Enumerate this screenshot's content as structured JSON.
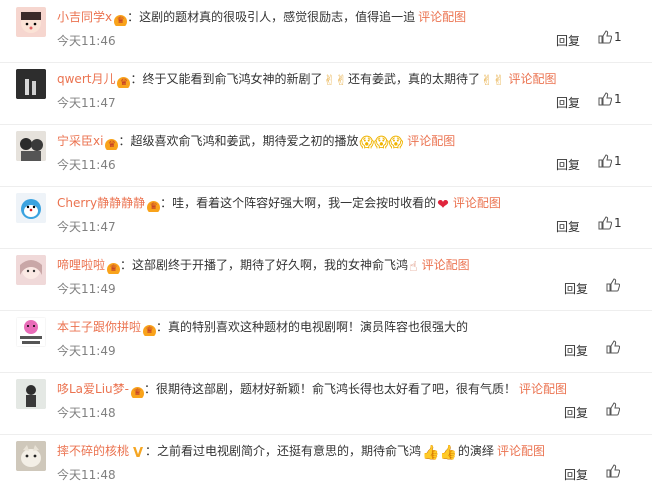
{
  "comments": [
    {
      "user": "小吉同学x",
      "text": "这剧的题材真的很吸引人，感觉很励志，值得追一追",
      "pic": "评论配图",
      "time": "今天11:46",
      "reply": "回复",
      "likes": "1",
      "emoji": ""
    },
    {
      "user": "qwert月儿",
      "text": "终于又能看到俞飞鸿女神的新剧了",
      "text2": "还有姜武，真的太期待了",
      "pic": "评论配图",
      "time": "今天11:47",
      "reply": "回复",
      "likes": "1",
      "emoji": "✌✌"
    },
    {
      "user": "宁采臣xi",
      "text": "超级喜欢俞飞鸿和姜武，期待爱之初的播放",
      "pic": "评论配图",
      "time": "今天11:46",
      "reply": "回复",
      "likes": "1",
      "emoji": "😱😱😱"
    },
    {
      "user": "Cherry静静静静",
      "text": "哇，看着这个阵容好强大啊，我一定会按时收看的",
      "pic": "评论配图",
      "time": "今天11:47",
      "reply": "回复",
      "likes": "1",
      "emoji": "❤"
    },
    {
      "user": "啼哩啦啦",
      "text": "这部剧终于开播了，期待了好久啊，我的女神俞飞鸿",
      "pic": "评论配图",
      "time": "今天11:49",
      "reply": "回复",
      "likes": "",
      "emoji": "☝"
    },
    {
      "user": "本王子跟你拼啦",
      "text": "真的特别喜欢这种题材的电视剧啊！演员阵容也很强大的",
      "pic": "",
      "time": "今天11:49",
      "reply": "回复",
      "likes": "",
      "emoji": ""
    },
    {
      "user": "哆La爱Liu梦-",
      "text": "很期待这部剧，题材好新颖！俞飞鸿长得也太好看了吧，很有气质！",
      "pic": "评论配图",
      "time": "今天11:48",
      "reply": "回复",
      "likes": "",
      "emoji": ""
    },
    {
      "user": "摔不碎的核桃",
      "text": "之前看过电视剧简介，还挺有意思的，期待俞飞鸿",
      "text2": "的演绎",
      "pic": "评论配图",
      "time": "今天11:48",
      "reply": "回复",
      "likes": "",
      "emoji": "👍👍"
    }
  ],
  "colors": {
    "username": "#eb7350",
    "link": "#eb7350",
    "time": "#808080",
    "text": "#333333"
  },
  "icons": {
    "like": "thumbs-up-icon",
    "badge": "vip-crown-icon"
  }
}
